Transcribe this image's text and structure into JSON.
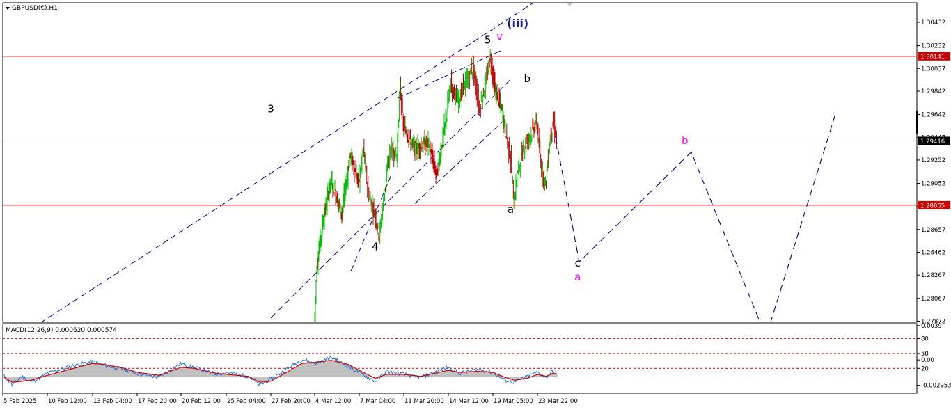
{
  "header": {
    "symbol_label": "GBPUSD(€),H1"
  },
  "indicator": {
    "label": "MACD(12,26,9) 0.000620 0.000574"
  },
  "colors": {
    "bull_candle": "#00c000",
    "bear_candle": "#c00000",
    "wave_line": "#00008b",
    "horizontal_line": "#d00000",
    "current_price_line": "#a0a0a0",
    "label_black": "#000000",
    "label_magenta": "#ff00ff",
    "label_navy": "#1a1aa8",
    "macd_histogram": "#c0c0c0",
    "macd_main": "#1e6fe0",
    "macd_signal": "#d00000"
  },
  "chart_data": [
    {
      "type": "candlestick",
      "symbol": "GBPUSD(€)",
      "timeframe": "H1",
      "y_axis_ticks": [
        1.30432,
        1.30232,
        1.30037,
        1.29842,
        1.29642,
        1.29447,
        1.29252,
        1.29052,
        1.28857,
        1.28657,
        1.28462,
        1.28267,
        1.28067,
        1.27872
      ],
      "ylim": [
        1.2785,
        1.3057
      ],
      "x_axis_labels": [
        "5 Feb 2025",
        "10 Feb 12:00",
        "13 Feb 04:00",
        "17 Feb 20:00",
        "20 Feb 12:00",
        "25 Feb 04:00",
        "27 Feb 20:00",
        "4 Mar 12:00",
        "7 Mar 04:00",
        "11 Mar 20:00",
        "14 Mar 12:00",
        "19 Mar 05:00",
        "23 Mar 22:00"
      ],
      "price_series": [
        {
          "t": "4 Mar 12:00",
          "p": 1.278
        },
        {
          "t": "4 Mar 16:00",
          "p": 1.2835
        },
        {
          "t": "5 Mar 00:00",
          "p": 1.287
        },
        {
          "t": "5 Mar 12:00",
          "p": 1.2908
        },
        {
          "t": "6 Mar 04:00",
          "p": 1.288
        },
        {
          "t": "6 Mar 16:00",
          "p": 1.293
        },
        {
          "t": "7 Mar 04:00",
          "p": 1.2905
        },
        {
          "t": "7 Mar 16:00",
          "p": 1.2935
        },
        {
          "t": "8 Mar 04:00",
          "p": 1.2898
        },
        {
          "t": "9 Mar 00:00",
          "p": 1.2875
        },
        {
          "t": "9 Mar 08:00",
          "p": 1.286
        },
        {
          "t": "9 Mar 20:00",
          "p": 1.2895
        },
        {
          "t": "10 Mar 12:00",
          "p": 1.2935
        },
        {
          "t": "11 Mar 04:00",
          "p": 1.293
        },
        {
          "t": "11 Mar 12:00",
          "p": 1.2988
        },
        {
          "t": "11 Mar 20:00",
          "p": 1.2955
        },
        {
          "t": "12 Mar 12:00",
          "p": 1.2935
        },
        {
          "t": "13 Mar 08:00",
          "p": 1.294
        },
        {
          "t": "13 Mar 20:00",
          "p": 1.2912
        },
        {
          "t": "14 Mar 08:00",
          "p": 1.2955
        },
        {
          "t": "14 Mar 20:00",
          "p": 1.2992
        },
        {
          "t": "15 Mar 12:00",
          "p": 1.2975
        },
        {
          "t": "17 Mar 04:00",
          "p": 1.3005
        },
        {
          "t": "17 Mar 20:00",
          "p": 1.297
        },
        {
          "t": "18 Mar 12:00",
          "p": 1.299
        },
        {
          "t": "19 Mar 00:00",
          "p": 1.3014
        },
        {
          "t": "19 Mar 12:00",
          "p": 1.2985
        },
        {
          "t": "20 Mar 04:00",
          "p": 1.297
        },
        {
          "t": "20 Mar 16:00",
          "p": 1.2948
        },
        {
          "t": "21 Mar 04:00",
          "p": 1.2925
        },
        {
          "t": "21 Mar 12:00",
          "p": 1.2888
        },
        {
          "t": "21 Mar 20:00",
          "p": 1.2912
        },
        {
          "t": "22 Mar 12:00",
          "p": 1.2935
        },
        {
          "t": "23 Mar 22:00",
          "p": 1.2958
        },
        {
          "t": "24 Mar 08:00",
          "p": 1.292
        },
        {
          "t": "24 Mar 20:00",
          "p": 1.2905
        },
        {
          "t": "25 Mar 08:00",
          "p": 1.2945
        },
        {
          "t": "25 Mar 16:00",
          "p": 1.2958
        },
        {
          "t": "26 Mar 00:00",
          "p": 1.2942
        }
      ],
      "horizontal_lines": [
        {
          "value": 1.30141,
          "label": "1.30141"
        },
        {
          "value": 1.28865,
          "label": "1.28865"
        }
      ],
      "current_price": {
        "value": 1.29416,
        "label": "1.29416"
      },
      "trend_lines": [
        {
          "t1": "6 Feb 14:00",
          "p1": 1.2772,
          "t2": "23 Mar 12:00",
          "p2": 1.306
        },
        {
          "t1": "11 Mar 04:00",
          "p1": 1.2978,
          "t2": "20 Mar 08:00",
          "p2": 1.302
        },
        {
          "t1": "27 Feb 20:00",
          "p1": 1.279,
          "t2": "21 Mar 04:00",
          "p2": 1.2995
        },
        {
          "t1": "6 Mar 16:00",
          "p1": 1.283,
          "t2": "10 Mar 12:00",
          "p2": 1.2912
        },
        {
          "t1": "12 Mar 12:00",
          "p1": 1.2888,
          "t2": "20 Mar 12:00",
          "p2": 1.296
        }
      ],
      "projection_path": [
        {
          "t": "25 Mar 20:00",
          "p": 1.2945
        },
        {
          "t": "28 Mar 08:00",
          "p": 1.2838
        },
        {
          "t": "9 Apr 04:00",
          "p": 1.2932
        },
        {
          "t": "16 Apr 12:00",
          "p": 1.2785
        },
        {
          "t": "17 Apr 12:00",
          "p": 1.2785
        },
        {
          "t": "24 Apr 12:00",
          "p": 1.2967
        }
      ],
      "wave_labels": [
        {
          "text": "3",
          "t": "27 Feb 20:00",
          "p": 1.2966,
          "color": "black"
        },
        {
          "text": "4",
          "t": "8 Mar 20:00",
          "p": 1.2848,
          "color": "black"
        },
        {
          "text": "5",
          "t": "18 Mar 16:00",
          "p": 1.3025,
          "color": "black"
        },
        {
          "text": "v",
          "t": "19 Mar 22:00",
          "p": 1.3028,
          "color": "magenta"
        },
        {
          "text": "(iii)",
          "t": "21 Mar 20:00",
          "p": 1.3039,
          "color": "navy"
        },
        {
          "text": "b",
          "t": "22 Mar 20:00",
          "p": 1.2992,
          "color": "black"
        },
        {
          "text": "a",
          "t": "21 Mar 02:00",
          "p": 1.288,
          "color": "black"
        },
        {
          "text": "c",
          "t": "28 Mar 04:00",
          "p": 1.2834,
          "color": "black"
        },
        {
          "text": "a",
          "t": "28 Mar 04:00",
          "p": 1.2822,
          "color": "magenta"
        },
        {
          "text": "b",
          "t": "8 Apr 12:00",
          "p": 1.2939,
          "color": "magenta"
        }
      ]
    },
    {
      "type": "line",
      "indicator": "MACD(12,26,9)",
      "main_value": 0.00062,
      "signal_value": 0.000574,
      "y_axis_ticks": [
        "0.0039",
        "80",
        "50",
        "0.00",
        "20",
        "-0.002953"
      ],
      "levels": [
        80,
        50,
        20
      ],
      "main_line": [
        {
          "t": "5 Feb 2025",
          "v": 8
        },
        {
          "t": "6 Feb 04:00",
          "v": -14
        },
        {
          "t": "7 Feb 08:00",
          "v": 4
        },
        {
          "t": "8 Feb 12:00",
          "v": -8
        },
        {
          "t": "10 Feb 12:00",
          "v": 10
        },
        {
          "t": "11 Feb 20:00",
          "v": 24
        },
        {
          "t": "13 Feb 04:00",
          "v": 34
        },
        {
          "t": "14 Feb 08:00",
          "v": 26
        },
        {
          "t": "16 Feb 12:00",
          "v": 18
        },
        {
          "t": "17 Feb 20:00",
          "v": 10
        },
        {
          "t": "19 Feb 04:00",
          "v": 2
        },
        {
          "t": "20 Feb 12:00",
          "v": 30
        },
        {
          "t": "21 Feb 20:00",
          "v": 22
        },
        {
          "t": "24 Feb 04:00",
          "v": 8
        },
        {
          "t": "25 Feb 04:00",
          "v": 12
        },
        {
          "t": "26 Feb 12:00",
          "v": 4
        },
        {
          "t": "27 Feb 04:00",
          "v": -14
        },
        {
          "t": "27 Feb 20:00",
          "v": -2
        },
        {
          "t": "3 Mar 04:00",
          "v": 38
        },
        {
          "t": "4 Mar 12:00",
          "v": 30
        },
        {
          "t": "5 Mar 12:00",
          "v": 42
        },
        {
          "t": "6 Mar 12:00",
          "v": 24
        },
        {
          "t": "7 Mar 04:00",
          "v": 12
        },
        {
          "t": "8 Mar 20:00",
          "v": -6
        },
        {
          "t": "10 Mar 00:00",
          "v": 14
        },
        {
          "t": "11 Mar 20:00",
          "v": 8
        },
        {
          "t": "12 Mar 20:00",
          "v": 2
        },
        {
          "t": "14 Mar 12:00",
          "v": 22
        },
        {
          "t": "15 Mar 16:00",
          "v": 10
        },
        {
          "t": "17 Mar 16:00",
          "v": 18
        },
        {
          "t": "19 Mar 05:00",
          "v": 12
        },
        {
          "t": "20 Mar 12:00",
          "v": -4
        },
        {
          "t": "21 Mar 12:00",
          "v": -8
        },
        {
          "t": "22 Mar 20:00",
          "v": 4
        },
        {
          "t": "23 Mar 22:00",
          "v": 12
        },
        {
          "t": "24 Mar 20:00",
          "v": 2
        },
        {
          "t": "25 Mar 12:00",
          "v": 14
        },
        {
          "t": "26 Mar 00:00",
          "v": 10
        }
      ],
      "signal_line": [
        {
          "t": "5 Feb 2025",
          "v": 4
        },
        {
          "t": "6 Feb 04:00",
          "v": -8
        },
        {
          "t": "7 Feb 08:00",
          "v": -6
        },
        {
          "t": "8 Feb 12:00",
          "v": -4
        },
        {
          "t": "10 Feb 12:00",
          "v": 6
        },
        {
          "t": "11 Feb 20:00",
          "v": 18
        },
        {
          "t": "13 Feb 04:00",
          "v": 30
        },
        {
          "t": "14 Feb 08:00",
          "v": 28
        },
        {
          "t": "16 Feb 12:00",
          "v": 20
        },
        {
          "t": "17 Feb 20:00",
          "v": 12
        },
        {
          "t": "19 Feb 04:00",
          "v": 6
        },
        {
          "t": "20 Feb 12:00",
          "v": 22
        },
        {
          "t": "21 Feb 20:00",
          "v": 20
        },
        {
          "t": "24 Feb 04:00",
          "v": 10
        },
        {
          "t": "25 Feb 04:00",
          "v": 8
        },
        {
          "t": "26 Feb 12:00",
          "v": 4
        },
        {
          "t": "27 Feb 04:00",
          "v": -8
        },
        {
          "t": "27 Feb 20:00",
          "v": -6
        },
        {
          "t": "3 Mar 04:00",
          "v": 30
        },
        {
          "t": "4 Mar 12:00",
          "v": 32
        },
        {
          "t": "5 Mar 12:00",
          "v": 36
        },
        {
          "t": "6 Mar 12:00",
          "v": 28
        },
        {
          "t": "7 Mar 04:00",
          "v": 16
        },
        {
          "t": "8 Mar 20:00",
          "v": 0
        },
        {
          "t": "10 Mar 00:00",
          "v": 8
        },
        {
          "t": "11 Mar 20:00",
          "v": 8
        },
        {
          "t": "12 Mar 20:00",
          "v": 4
        },
        {
          "t": "14 Mar 12:00",
          "v": 16
        },
        {
          "t": "15 Mar 16:00",
          "v": 12
        },
        {
          "t": "17 Mar 16:00",
          "v": 14
        },
        {
          "t": "19 Mar 05:00",
          "v": 12
        },
        {
          "t": "20 Mar 12:00",
          "v": 2
        },
        {
          "t": "21 Mar 12:00",
          "v": -4
        },
        {
          "t": "22 Mar 20:00",
          "v": 0
        },
        {
          "t": "23 Mar 22:00",
          "v": 8
        },
        {
          "t": "24 Mar 20:00",
          "v": 4
        },
        {
          "t": "25 Mar 12:00",
          "v": 10
        },
        {
          "t": "26 Mar 00:00",
          "v": 9
        }
      ]
    }
  ]
}
